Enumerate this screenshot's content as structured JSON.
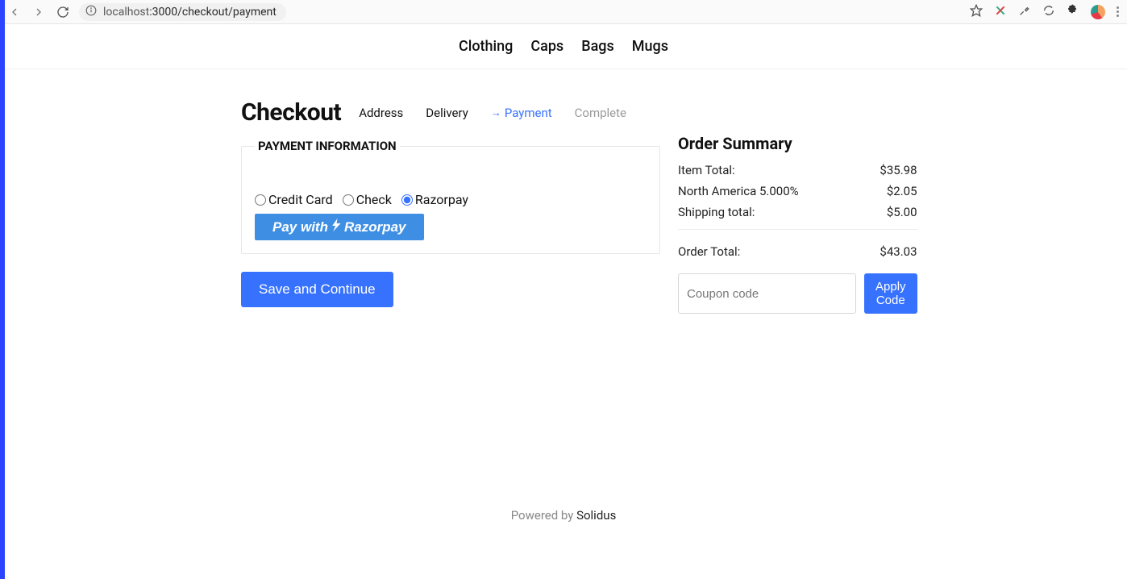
{
  "browser": {
    "url_host": "localhost",
    "url_port_path": ":3000/checkout/payment"
  },
  "nav": {
    "items": [
      "Clothing",
      "Caps",
      "Bags",
      "Mugs"
    ]
  },
  "checkout": {
    "title": "Checkout",
    "steps": {
      "address": "Address",
      "delivery": "Delivery",
      "payment": "Payment",
      "complete": "Complete"
    },
    "payment_info_legend": "PAYMENT INFORMATION",
    "payment_methods": {
      "credit": "Credit Card",
      "check": "Check",
      "razorpay": "Razorpay"
    },
    "razorpay_button_prefix": "Pay with ",
    "razorpay_button_brand": "Razorpay",
    "save_button": "Save and Continue"
  },
  "summary": {
    "title": "Order Summary",
    "item_total_label": "Item Total:",
    "item_total_value": "$35.98",
    "tax_label": "North America 5.000%",
    "tax_value": "$2.05",
    "shipping_label": "Shipping total:",
    "shipping_value": "$5.00",
    "order_total_label": "Order Total:",
    "order_total_value": "$43.03",
    "coupon_placeholder": "Coupon code",
    "apply_button": "Apply Code"
  },
  "footer": {
    "prefix": "Powered by ",
    "brand": "Solidus"
  }
}
